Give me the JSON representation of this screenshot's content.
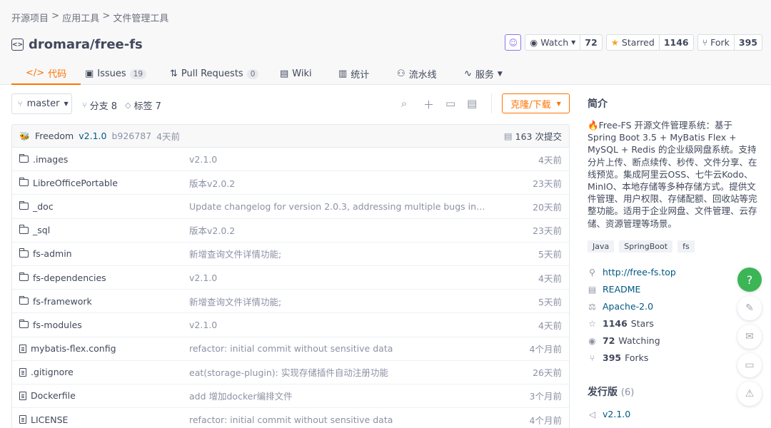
{
  "breadcrumb": [
    "开源项目",
    " > ",
    "应用工具",
    " > ",
    "文件管理工具"
  ],
  "repo": {
    "name": "dromara/free-fs"
  },
  "actions": {
    "watch_label": "Watch",
    "watch_count": "72",
    "star_label": "Starred",
    "star_count": "1146",
    "fork_label": "Fork",
    "fork_count": "395"
  },
  "tabs": [
    {
      "label": "代码",
      "icon": "code-icon"
    },
    {
      "label": "Issues",
      "badge": "19",
      "icon": "issues-icon"
    },
    {
      "label": "Pull Requests",
      "badge": "0",
      "icon": "pr-icon"
    },
    {
      "label": "Wiki",
      "icon": "wiki-icon"
    },
    {
      "label": "统计",
      "icon": "chart-icon"
    },
    {
      "label": "流水线",
      "icon": "pipeline-icon"
    },
    {
      "label": "服务",
      "icon": "service-icon"
    }
  ],
  "toolbar": {
    "branch": "master",
    "branches": "分支 8",
    "tags": "标签 7",
    "clone": "克隆/下载"
  },
  "commit": {
    "author": "Freedom",
    "version": "v2.1.0",
    "hash": "b926787",
    "time": "4天前",
    "total": "163 次提交"
  },
  "files": [
    {
      "name": ".images",
      "type": "folder",
      "msg": "v2.1.0",
      "time": "4天前"
    },
    {
      "name": "LibreOfficePortable",
      "type": "folder",
      "msg": "版本v2.0.2",
      "time": "23天前"
    },
    {
      "name": "_doc",
      "type": "folder",
      "msg": "Update changelog for version 2.0.3, addressing multiple bugs including...",
      "time": "20天前"
    },
    {
      "name": "_sql",
      "type": "folder",
      "msg": "版本v2.0.2",
      "time": "23天前"
    },
    {
      "name": "fs-admin",
      "type": "folder",
      "msg": "新增查询文件详情功能;",
      "time": "5天前"
    },
    {
      "name": "fs-dependencies",
      "type": "folder",
      "msg": "v2.1.0",
      "time": "4天前"
    },
    {
      "name": "fs-framework",
      "type": "folder",
      "msg": "新增查询文件详情功能;",
      "time": "5天前"
    },
    {
      "name": "fs-modules",
      "type": "folder",
      "msg": "v2.1.0",
      "time": "4天前"
    },
    {
      "name": "mybatis-flex.config",
      "type": "file",
      "msg": "refactor: initial commit without sensitive data",
      "time": "4个月前"
    },
    {
      "name": ".gitignore",
      "type": "file",
      "msg": "eat(storage-plugin): 实现存储插件自动注册功能",
      "time": "26天前"
    },
    {
      "name": "Dockerfile",
      "type": "file",
      "msg": "add 增加docker编排文件",
      "time": "3个月前"
    },
    {
      "name": "LICENSE",
      "type": "file",
      "msg": "refactor: initial commit without sensitive data",
      "time": "4个月前"
    }
  ],
  "sidebar": {
    "intro_title": "简介",
    "description": "🔥Free-FS 开源文件管理系统：基于 Spring Boot 3.5 + MyBatis Flex + MySQL + Redis 的企业级网盘系统。支持分片上传、断点续传、秒传、文件分享、在线预览。集成阿里云OSS、七牛云Kodo、MinIO、本地存储等多种存储方式。提供文件管理、用户权限、存储配额、回收站等完整功能。适用于企业网盘、文件管理、云存储、资源管理等场景。",
    "tags": [
      "Java",
      "SpringBoot",
      "fs"
    ],
    "homepage": "http://free-fs.top",
    "readme": "README",
    "license": "Apache-2.0",
    "stars_num": "1146",
    "stars_label": "Stars",
    "watching_num": "72",
    "watching_label": "Watching",
    "forks_num": "395",
    "forks_label": "Forks",
    "releases_title": "发行版",
    "releases_count": "(6)",
    "latest_release": "v2.1.0"
  },
  "colors": {
    "accent": "#fe7300",
    "link": "#005980",
    "help": "#3cb556",
    "bot": "#8f74e8"
  }
}
